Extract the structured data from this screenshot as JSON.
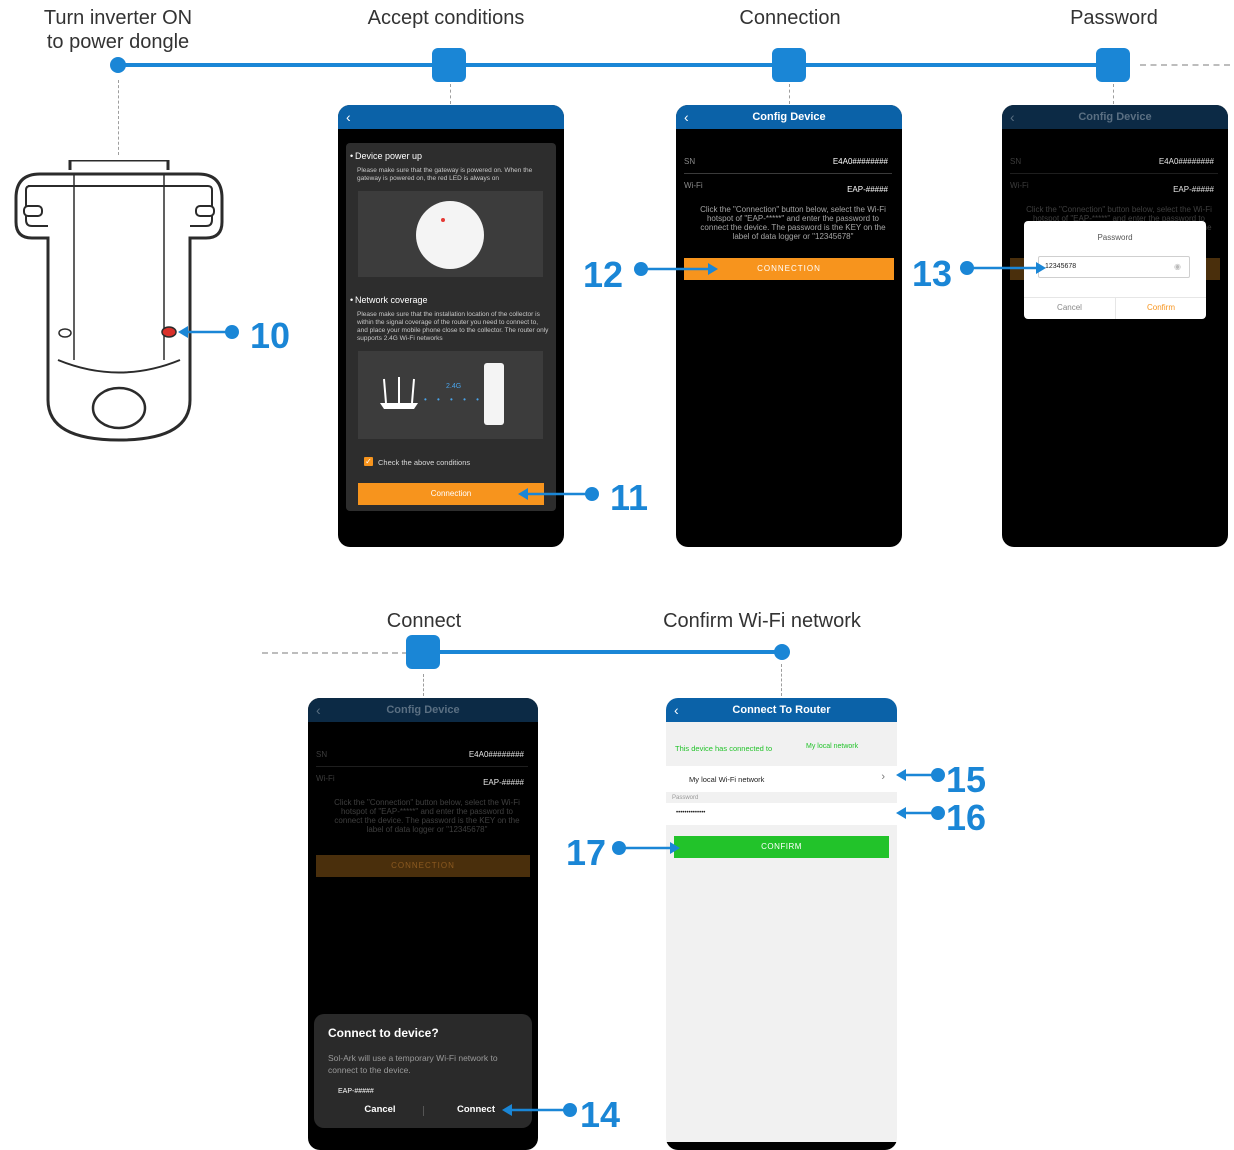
{
  "steps_top": [
    {
      "label_line1": "Turn inverter ON",
      "label_line2": "to power dongle"
    },
    {
      "label": "Accept conditions"
    },
    {
      "label": "Connection"
    },
    {
      "label": "Password"
    }
  ],
  "steps_bottom": [
    {
      "label": "Connect"
    },
    {
      "label": "Confirm Wi-Fi network"
    }
  ],
  "callouts": {
    "n10": "10",
    "n11": "11",
    "n12": "12",
    "n13": "13",
    "n14": "14",
    "n15": "15",
    "n16": "16",
    "n17": "17"
  },
  "screen_conditions": {
    "section1_title": "Device power up",
    "section1_text": "Please make sure that the gateway is powered on. When the gateway is powered on, the red LED is always on",
    "section2_title": "Network coverage",
    "section2_text": "Please make sure that the installation location of the collector is within the signal coverage of the router you need to connect to, and place your mobile phone close to the collector. The router only supports 2.4G Wi-Fi networks",
    "band_label": "2.4G",
    "checkbox_label": "Check the above conditions",
    "connection_button": "Connection"
  },
  "screen_config": {
    "title": "Config Device",
    "sn_label": "SN",
    "sn_value": "E4A0########",
    "wifi_label": "Wi-Fi",
    "wifi_value": "EAP-#####",
    "instructions": "Click the \"Connection\" button below, select the Wi-Fi hotspot of \"EAP-*****\" and enter the password to connect the device. The password is the KEY on the label of data logger or \"12345678\"",
    "connection_button": "CONNECTION"
  },
  "password_dialog": {
    "title": "Password",
    "value": "12345678",
    "cancel": "Cancel",
    "confirm": "Confirm"
  },
  "connect_dialog": {
    "title": "Connect to device?",
    "text": "Sol-Ark will use a temporary Wi-Fi network to connect to the device.",
    "network": "EAP-#####",
    "cancel": "Cancel",
    "connect": "Connect"
  },
  "router_screen": {
    "title": "Connect To Router",
    "status_text": "This device has connected to",
    "status_network": "My local network",
    "network_name": "My local Wi-Fi network",
    "password_label": "Password",
    "password_value": "••••••••••••••",
    "confirm_button": "CONFIRM"
  },
  "colors": {
    "accent": "#1a86d6",
    "orange": "#f7941d",
    "green": "#22c32a",
    "header": "#0b62a8"
  }
}
